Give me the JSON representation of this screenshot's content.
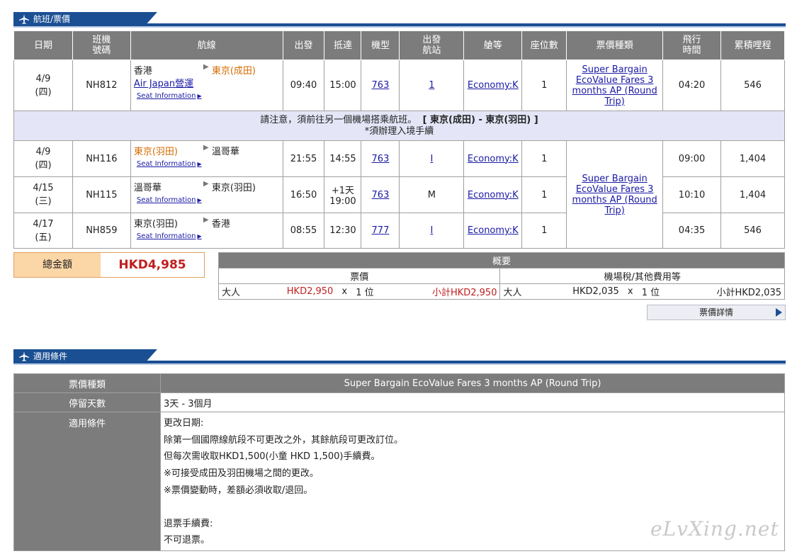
{
  "section1": {
    "title": "航班/票價"
  },
  "section2": {
    "title": "適用條件"
  },
  "table": {
    "headers": [
      "日期",
      "班機\n號碼",
      "航線",
      "出發",
      "抵達",
      "機型",
      "出發\n航站",
      "艙等",
      "座位數",
      "票價種類",
      "飛行\n時間",
      "累積哩程"
    ],
    "seat_info": "Seat Information",
    "fare_type": "Super Bargain EcoValue Fares 3 months AP (Round Trip)",
    "flights": [
      {
        "date": "4/9",
        "dow": "(四)",
        "flight": "NH812",
        "from": "香港",
        "to": "東京(成田)",
        "airline": "Air Japan營運",
        "dep": "09:40",
        "arr": "15:00",
        "aircraft": "763",
        "terminal": "1",
        "class": "Economy:K",
        "seats": "1",
        "duration": "04:20",
        "miles": "546"
      },
      {
        "date": "4/9",
        "dow": "(四)",
        "flight": "NH116",
        "from": "東京(羽田)",
        "to": "溫哥華",
        "dep": "21:55",
        "arr": "14:55",
        "aircraft": "763",
        "terminal": "I",
        "class": "Economy:K",
        "seats": "1",
        "duration": "09:00",
        "miles": "1,404"
      },
      {
        "date": "4/15",
        "dow": "(三)",
        "flight": "NH115",
        "from": "溫哥華",
        "to": "東京(羽田)",
        "dep": "16:50",
        "arr_day": "+1天",
        "arr": "19:00",
        "aircraft": "763",
        "terminal": "M",
        "class": "Economy:K",
        "seats": "1",
        "duration": "10:10",
        "miles": "1,404"
      },
      {
        "date": "4/17",
        "dow": "(五)",
        "flight": "NH859",
        "from": "東京(羽田)",
        "to": "香港",
        "dep": "08:55",
        "arr": "12:30",
        "aircraft": "777",
        "terminal": "I",
        "class": "Economy:K",
        "seats": "1",
        "duration": "04:35",
        "miles": "546"
      }
    ],
    "notice": {
      "line1": "請注意，須前往另一個機場搭乘航班。",
      "airports": "[ 東京(成田) - 東京(羽田) ]",
      "line2": "*須辦理入境手續"
    }
  },
  "total": {
    "label": "總金額",
    "amount": "HKD4,985"
  },
  "summary": {
    "title": "概要",
    "fare_header": "票價",
    "tax_header": "機場稅/其他費用等",
    "pax": "大人",
    "fare_unit": "HKD2,950",
    "times": "x",
    "count": "1 位",
    "fare_subtotal": "小計HKD2,950",
    "tax_unit": "HKD2,035",
    "tax_subtotal": "小計HKD2,035",
    "detail_button": "票價詳情"
  },
  "conditions": {
    "fare_type_label": "票價種類",
    "fare_type_value": "Super Bargain EcoValue Fares 3 months AP (Round Trip)",
    "stay_label": "停留天數",
    "stay_value": "3天 - 3個月",
    "rules_label": "適用條件",
    "rules_lines": [
      "更改日期:",
      "除第一個國際線航段不可更改之外，其餘航段可更改訂位。",
      "但每次需收取HKD1,500(小童 HKD 1,500)手續費。",
      "※可接受成田及羽田機場之間的更改。",
      "※票價變動時，差額必須收取/退回。",
      "",
      "退票手續費:",
      "不可退票。"
    ]
  },
  "watermark": "eLvXing.net"
}
